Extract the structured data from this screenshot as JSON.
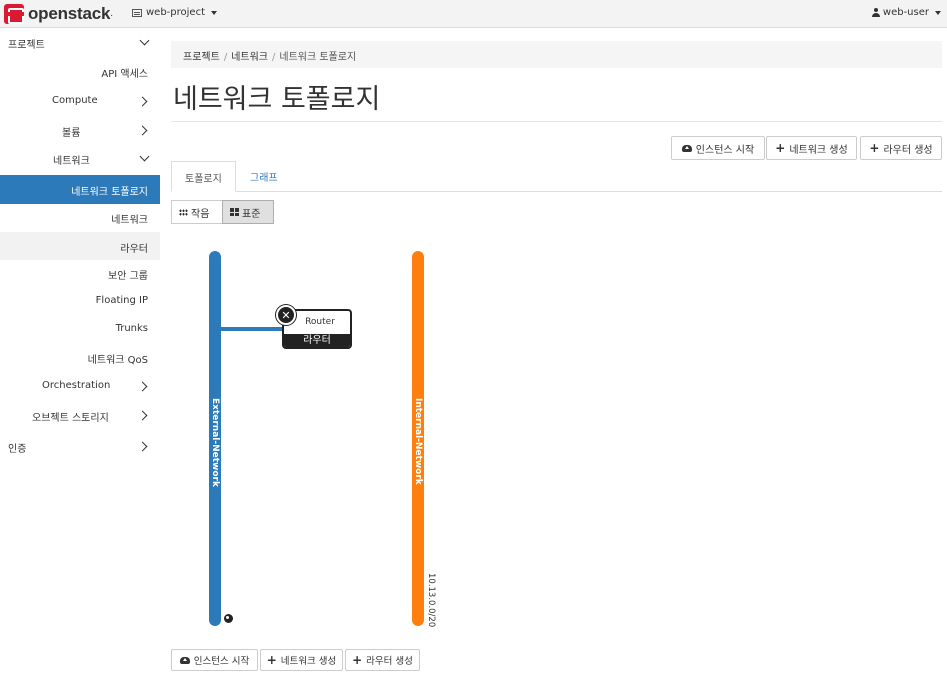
{
  "header": {
    "logo_text": "openstack",
    "project": "web-project",
    "user": "web-user"
  },
  "sidebar": {
    "items": [
      {
        "label": "프로젝트",
        "state": "expanded"
      },
      {
        "label": "API 액세스"
      },
      {
        "label": "Compute",
        "state": "collapsed"
      },
      {
        "label": "볼륨",
        "state": "collapsed"
      },
      {
        "label": "네트워크",
        "state": "expanded"
      },
      {
        "label": "네트워크 토폴로지",
        "state": "active"
      },
      {
        "label": "네트워크"
      },
      {
        "label": "라우터"
      },
      {
        "label": "보안 그룹"
      },
      {
        "label": "Floating IP"
      },
      {
        "label": "Trunks"
      },
      {
        "label": "네트워크 QoS"
      },
      {
        "label": "Orchestration",
        "state": "collapsed"
      },
      {
        "label": "오브젝트 스토리지",
        "state": "collapsed"
      },
      {
        "label": "인증",
        "state": "collapsed"
      }
    ]
  },
  "breadcrumb": {
    "items": [
      "프로젝트",
      "네트워크",
      "네트워크 토폴로지"
    ]
  },
  "page": {
    "title": "네트워크 토폴로지"
  },
  "actions": {
    "launch_instance": "인스턴스 시작",
    "create_network": "네트워크 생성",
    "create_router": "라우터 생성"
  },
  "tabs": {
    "topology": "토폴로지",
    "graph": "그래프"
  },
  "view_toggle": {
    "small": "작음",
    "normal": "표준",
    "selected": "normal"
  },
  "topology": {
    "networks": [
      {
        "name": "External-Network",
        "color": "#2c7ab9",
        "external": true
      },
      {
        "name": "Internal-Network",
        "color": "#ff7f0e",
        "cidr": "10.13.0.0/20"
      }
    ],
    "router": {
      "name": "Router",
      "type": "라우터"
    }
  },
  "colors": {
    "accent": "#2c7ab9",
    "brand": "#da1a32",
    "internal_network": "#ff7f0e"
  }
}
